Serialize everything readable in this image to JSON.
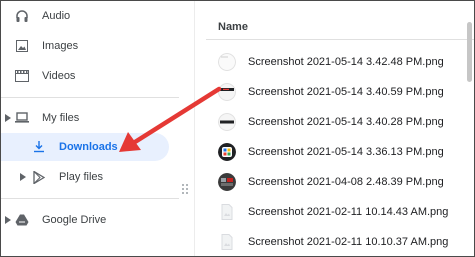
{
  "sidebar": {
    "items": [
      {
        "label": "Audio",
        "icon": "headphones-icon"
      },
      {
        "label": "Images",
        "icon": "image-icon"
      },
      {
        "label": "Videos",
        "icon": "film-icon"
      }
    ],
    "my_files": {
      "label": "My files",
      "icon": "laptop-icon"
    },
    "downloads": {
      "label": "Downloads",
      "icon": "download-icon",
      "selected": true
    },
    "play_files": {
      "label": "Play files",
      "icon": "play-store-icon"
    },
    "google_drive": {
      "label": "Google Drive",
      "icon": "drive-icon"
    }
  },
  "file_list": {
    "column_header": "Name",
    "files": [
      {
        "name": "Screenshot 2021-05-14 3.42.48 PM.png"
      },
      {
        "name": "Screenshot 2021-05-14 3.40.59 PM.png"
      },
      {
        "name": "Screenshot 2021-05-14 3.40.28 PM.png"
      },
      {
        "name": "Screenshot 2021-05-14 3.36.13 PM.png"
      },
      {
        "name": "Screenshot 2021-04-08 2.48.39 PM.png"
      },
      {
        "name": "Screenshot 2021-02-11 10.14.43 AM.png"
      },
      {
        "name": "Screenshot 2021-02-11 10.10.37 AM.png"
      }
    ]
  },
  "colors": {
    "accent": "#1a73e8",
    "selection_bg": "#e8f0fe",
    "arrow": "#e53935"
  }
}
